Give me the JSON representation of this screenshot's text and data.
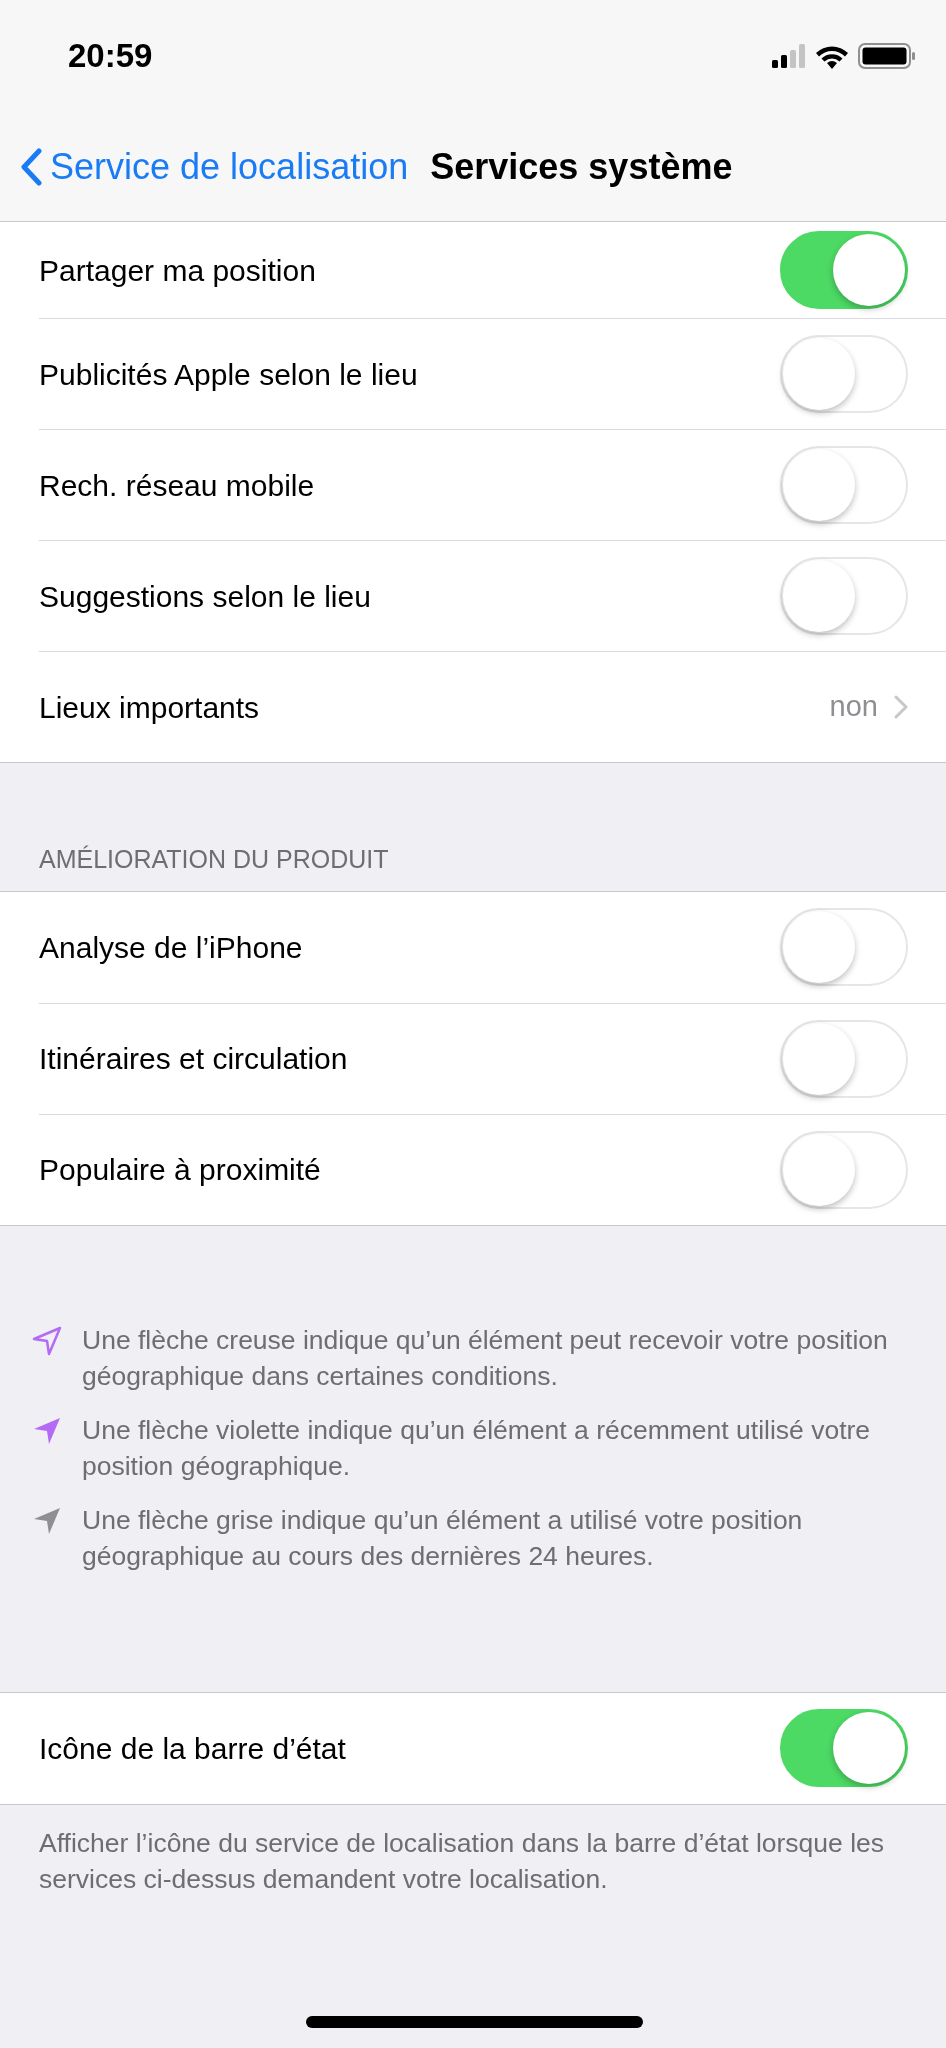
{
  "status_bar": {
    "time": "20:59"
  },
  "nav_bar": {
    "back": "Service de localisation",
    "title": "Services système"
  },
  "sections": [
    {
      "rows": [
        {
          "kind": "toggle",
          "label": "Partager ma position",
          "on": true
        },
        {
          "kind": "toggle",
          "label": "Publicités Apple selon le lieu",
          "on": false
        },
        {
          "kind": "toggle",
          "label": "Rech. réseau mobile",
          "on": false
        },
        {
          "kind": "toggle",
          "label": "Suggestions selon le lieu",
          "on": false
        },
        {
          "kind": "link",
          "label": "Lieux importants",
          "value": "non"
        }
      ]
    },
    {
      "header": "AMÉLIORATION DU PRODUIT",
      "rows": [
        {
          "kind": "toggle",
          "label": "Analyse de l’iPhone",
          "on": false
        },
        {
          "kind": "toggle",
          "label": "Itinéraires et circulation",
          "on": false
        },
        {
          "kind": "toggle",
          "label": "Populaire à proximité",
          "on": false
        }
      ]
    },
    {
      "legend": [
        {
          "kind": "outline",
          "color": "#b36bf5",
          "text": "Une flèche creuse indique qu’un élément peut recevoir votre position géographique dans certaines conditions."
        },
        {
          "kind": "solid",
          "color": "#b36bf5",
          "text": "Une flèche violette indique qu’un élément a récemment utilisé votre position géographique."
        },
        {
          "kind": "solid",
          "color": "#8e8e93",
          "text": "Une flèche grise indique qu’un élément a utilisé votre position géographique au cours des dernières 24 heures."
        }
      ]
    },
    {
      "rows": [
        {
          "kind": "toggle",
          "label": "Icône de la barre d’état",
          "on": true
        }
      ],
      "footer": "Afficher l’icône du service de localisation dans la barre d’état lorsque les services ci-dessus demandent votre localisation."
    }
  ]
}
